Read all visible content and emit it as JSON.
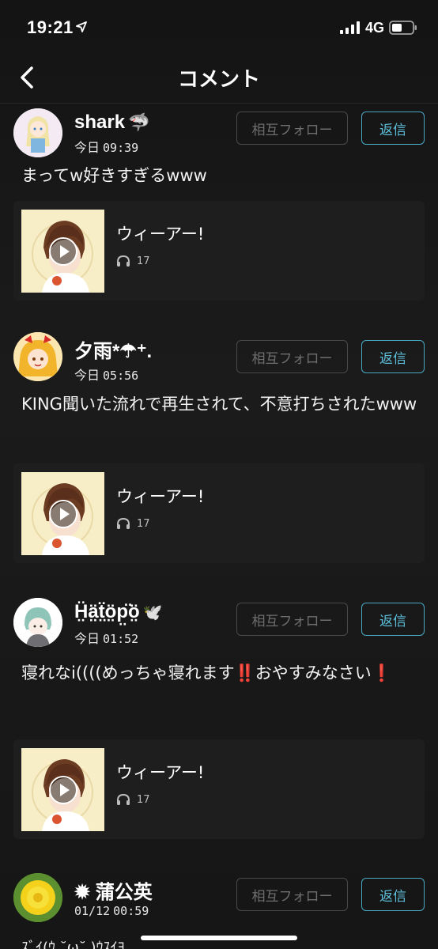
{
  "status": {
    "time": "19:21",
    "network": "4G"
  },
  "nav": {
    "title": "コメント"
  },
  "comments": [
    {
      "user": "shark",
      "user_emoji": "🦈",
      "date_label": "今日",
      "time": "09:39",
      "text": "まってw好きすぎるwww",
      "follow_label": "相互フォロー",
      "reply_label": "返信",
      "track": {
        "title": "ウィーアー!",
        "plays": "17"
      }
    },
    {
      "user": "夕雨*☂︎⁺.",
      "date_label": "今日",
      "time": "05:56",
      "text": "KING聞いた流れで再生されて、不意打ちされたwww",
      "follow_label": "相互フォロー",
      "reply_label": "返信",
      "track": {
        "title": "ウィーアー!",
        "plays": "17"
      }
    },
    {
      "user": "Ḧ̤ä̤ẗ̤ö̤p̤̈ö̤",
      "user_emoji": "🕊️",
      "date_label": "今日",
      "time": "01:52",
      "text_parts": [
        "寝れなi((((めっちゃ寝れます",
        "‼️",
        "おやすみなさい",
        "❗"
      ],
      "follow_label": "相互フォロー",
      "reply_label": "返信",
      "track": {
        "title": "ウィーアー!",
        "plays": "17"
      }
    },
    {
      "user": "✹ 蒲公英",
      "date_label": "01/12",
      "time": "00:59",
      "text": "ｽﾞｲ(ｳ ˘ω˘ )ｳｽｲﾖ",
      "follow_label": "相互フォロー",
      "reply_label": "返信"
    }
  ],
  "colors": {
    "accent": "#5ec0dc",
    "background": "#161616",
    "card": "#1e1e1e"
  }
}
